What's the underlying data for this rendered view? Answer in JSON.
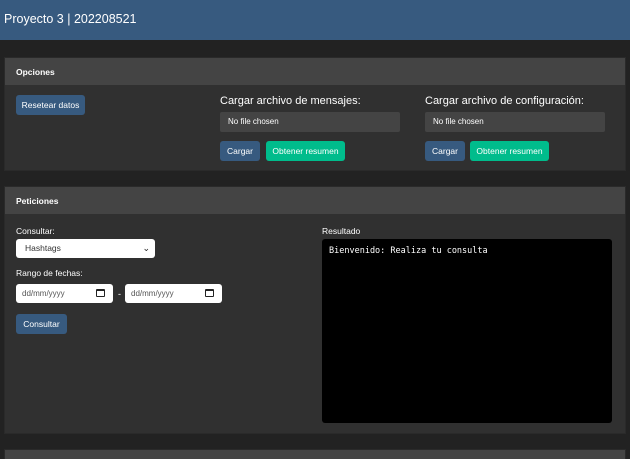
{
  "navbar": {
    "brand": "Proyecto 3 | 202208521"
  },
  "opciones": {
    "title": "Opciones",
    "reset_label": "Resetear datos",
    "mensajes": {
      "title": "Cargar archivo de mensajes:",
      "file_text": "No file chosen",
      "cargar_label": "Cargar",
      "resumen_label": "Obtener resumen"
    },
    "configuracion": {
      "title": "Cargar archivo de configuración:",
      "file_text": "No file chosen",
      "cargar_label": "Cargar",
      "resumen_label": "Obtener resumen"
    }
  },
  "peticiones": {
    "title": "Peticiones",
    "consultar_label": "Consultar:",
    "select_value": "Hashtags",
    "rango_label": "Rango de fechas:",
    "date_from": "dd/mm/yyyy",
    "date_sep": "-",
    "date_to": "dd/mm/yyyy",
    "consultar_button": "Consultar",
    "resultado_label": "Resultado",
    "resultado_text": "Bienvenido: Realiza tu consulta"
  },
  "icons": {
    "select_chevron": "chevron-down-icon",
    "date_picker": "calendar-icon"
  },
  "colors": {
    "navbar": "#375a7f",
    "primary": "#375a7f",
    "success": "#00bc8c",
    "background": "#222222",
    "card": "#303030",
    "card_header": "#444444"
  }
}
